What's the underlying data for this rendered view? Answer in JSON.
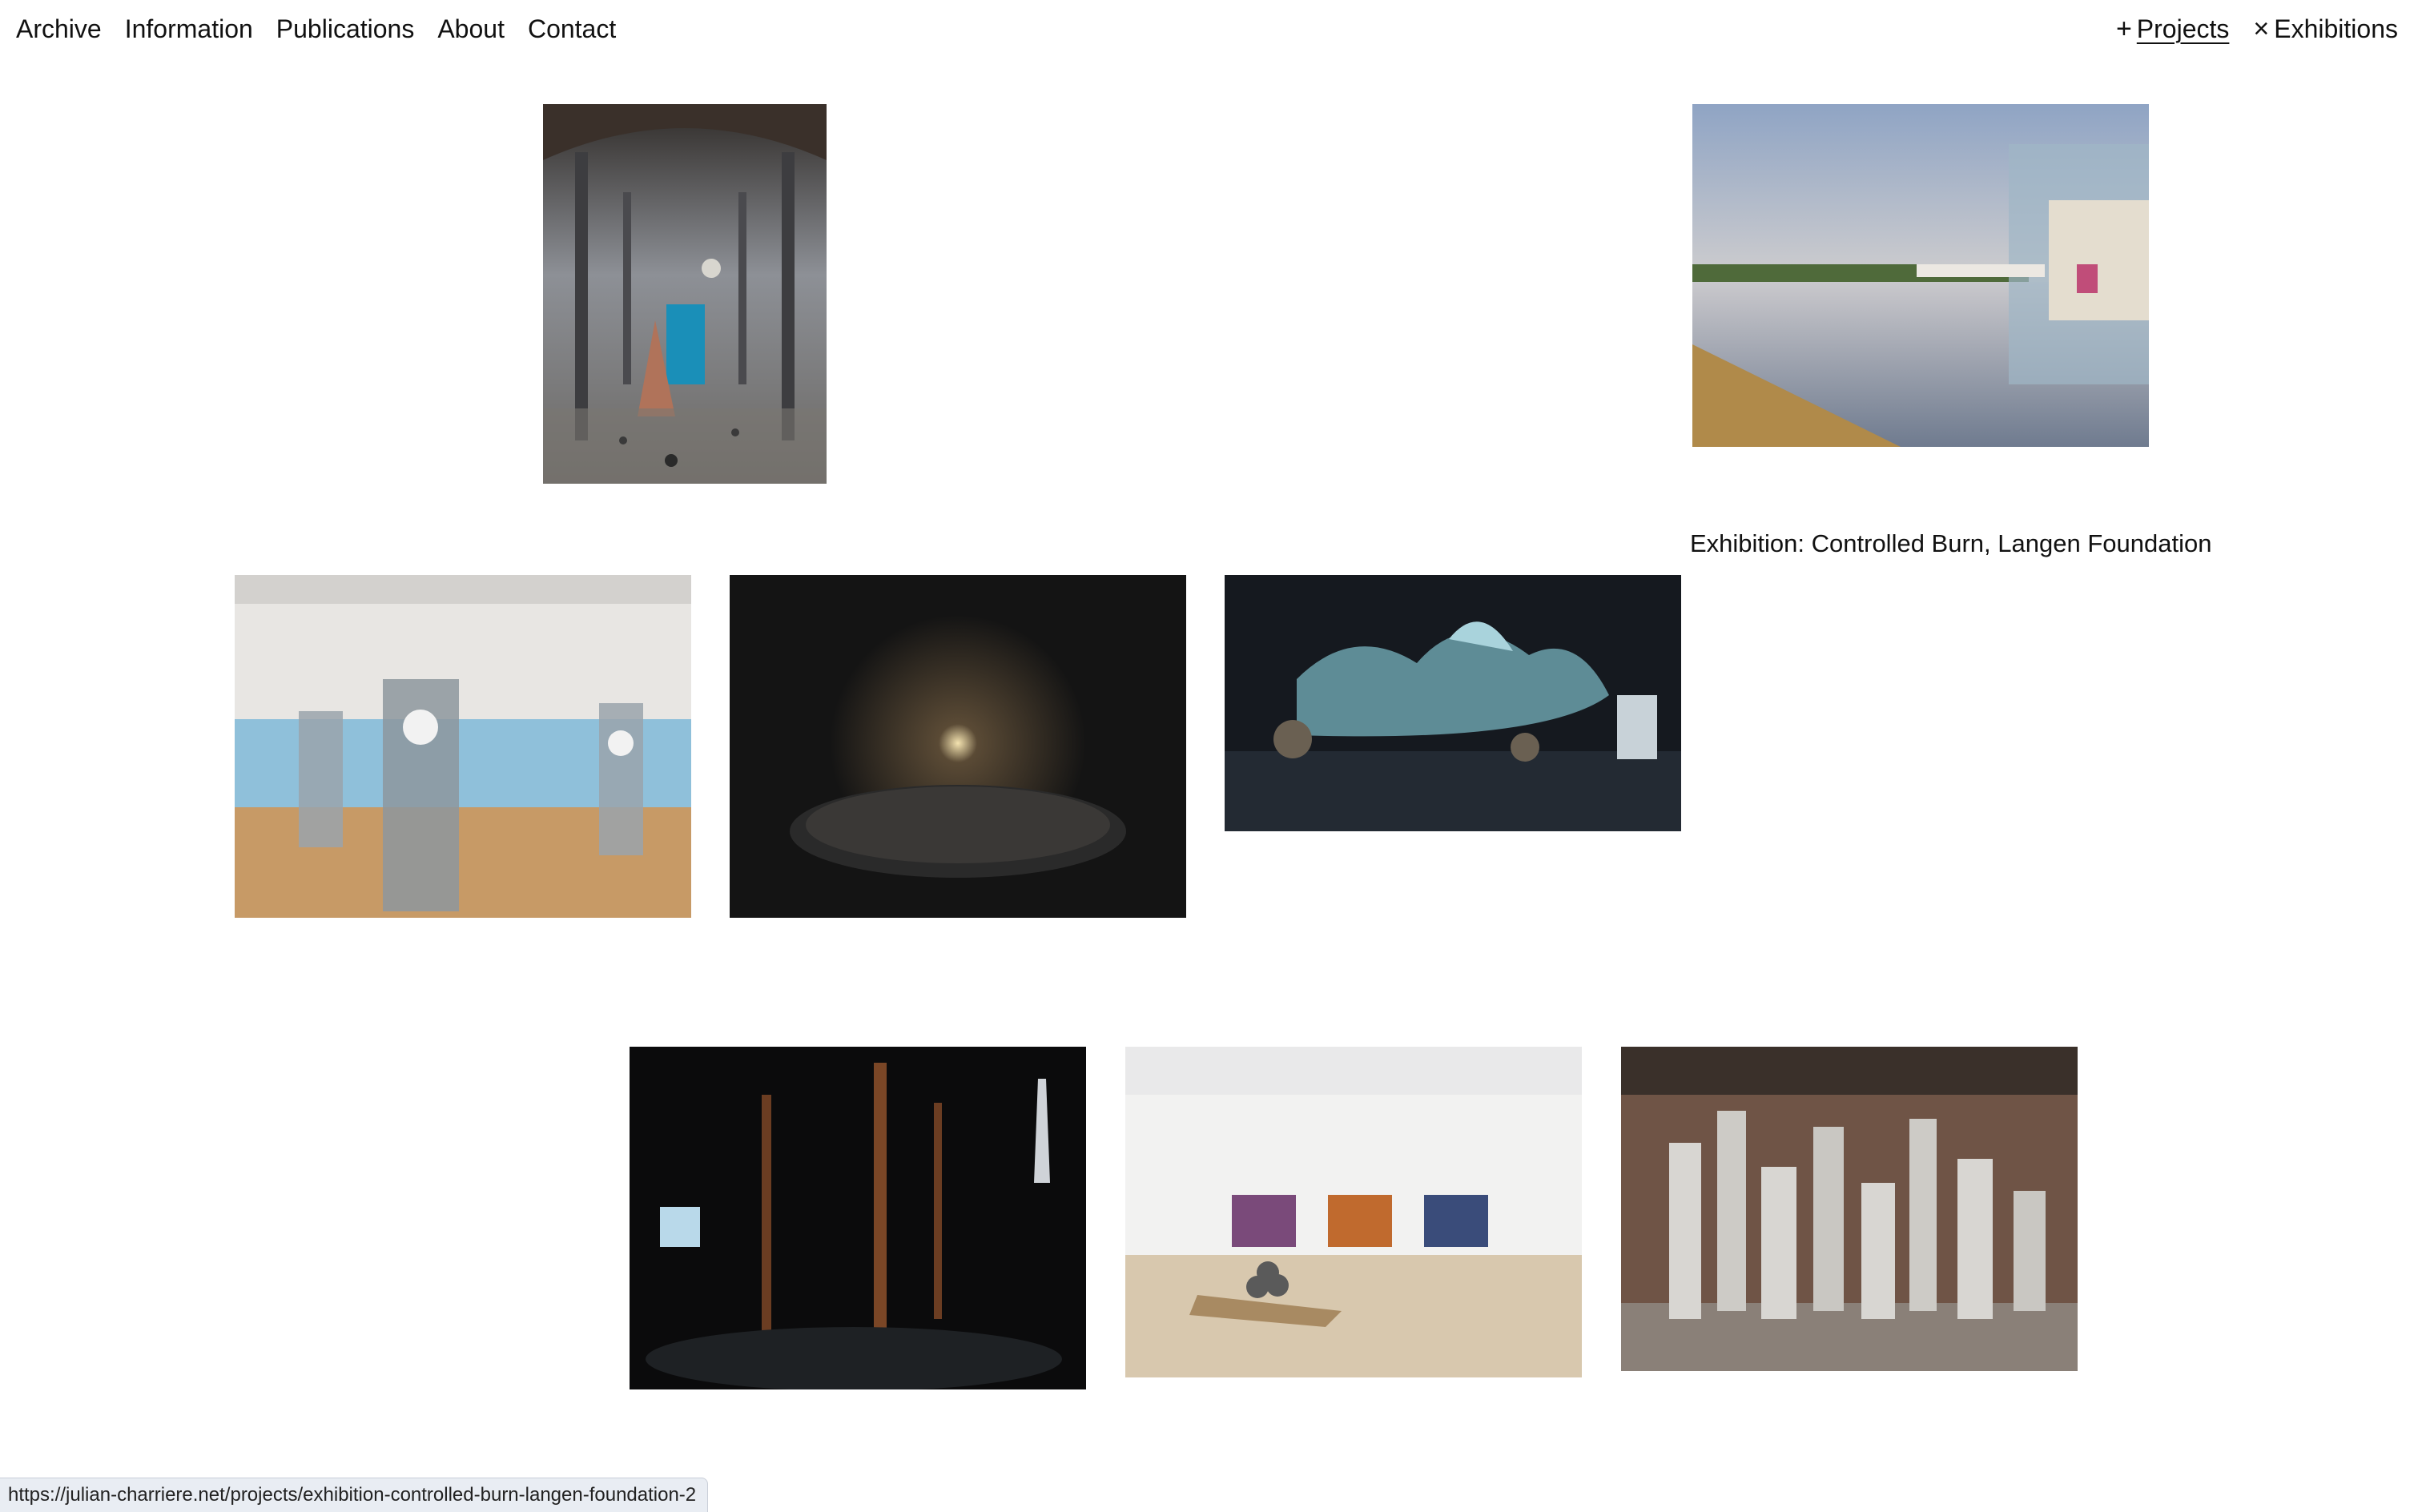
{
  "nav": {
    "items": [
      {
        "label": "Archive"
      },
      {
        "label": "Information"
      },
      {
        "label": "Publications"
      },
      {
        "label": "About"
      },
      {
        "label": "Contact"
      }
    ]
  },
  "filters": {
    "projects": {
      "glyph": "+",
      "label": "Projects",
      "active": true
    },
    "exhibitions": {
      "glyph": "×",
      "label": "Exhibitions",
      "active": false
    }
  },
  "hover_caption": "Exhibition: Controlled Burn, Langen Foundation",
  "status_url": "https://julian-charriere.net/projects/exhibition-controlled-burn-langen-foundation-2",
  "colors": {
    "background": "#ffffff",
    "text": "#111111",
    "status_bg": "#e9edf3"
  }
}
